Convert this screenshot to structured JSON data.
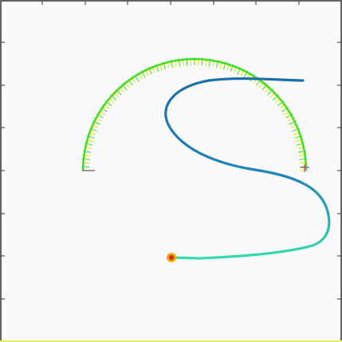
{
  "canvas": {
    "background": "#fafafd",
    "frame_color": "#333333",
    "tick_color": "#333333",
    "bottom_edge_color": "#e8e86a"
  },
  "semicircle": {
    "description_icon": "half-ring-brush-icon",
    "outer_color": "#e8e800",
    "inner_color": "#33dd33",
    "hatch_color": "#33dd33"
  },
  "left_marker": {
    "color": "#777777"
  },
  "right_marker": {
    "color": "#cc3399"
  },
  "path": {
    "color_start": "#1a6fa8",
    "color_mid": "#1f85b8",
    "color_end": "#33ddaa"
  },
  "end_point": {
    "icon": "target-dot-icon",
    "outer_color": "#f2a900",
    "inner_color": "#cc3311"
  }
}
